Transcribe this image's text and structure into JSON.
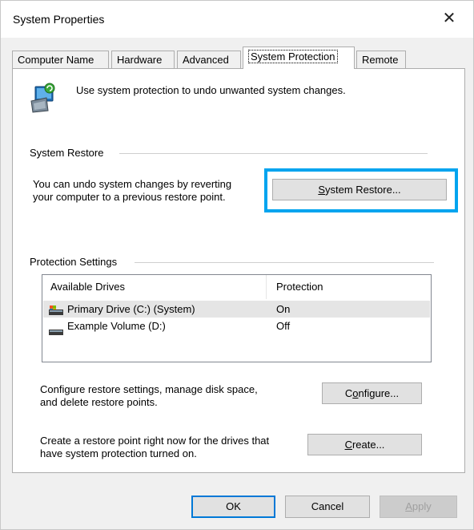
{
  "window": {
    "title": "System Properties",
    "close_glyph": "✕"
  },
  "tabs": [
    {
      "label": "Computer Name",
      "active": false
    },
    {
      "label": "Hardware",
      "active": false
    },
    {
      "label": "Advanced",
      "active": false
    },
    {
      "label": "System Protection",
      "active": true
    },
    {
      "label": "Remote",
      "active": false
    }
  ],
  "intro": {
    "icon": "system-protection-icon",
    "text": "Use system protection to undo unwanted system changes."
  },
  "system_restore": {
    "group_label": "System Restore",
    "description_line1": "You can undo system changes by reverting",
    "description_line2": "your computer to a previous restore point.",
    "button_label_prefix": "S",
    "button_label_rest": "ystem Restore...",
    "highlight_color": "#00a4ef"
  },
  "protection": {
    "group_label": "Protection Settings",
    "columns": [
      "Available Drives",
      "Protection"
    ],
    "drives": [
      {
        "name": "Primary Drive (C:) (System)",
        "protection": "On",
        "icon": "system-drive-icon",
        "selected": true
      },
      {
        "name": "Example Volume (D:)",
        "protection": "Off",
        "icon": "drive-icon",
        "selected": false
      }
    ]
  },
  "configure": {
    "line1": "Configure restore settings, manage disk space,",
    "line2": "and delete restore points.",
    "button_pre": "C",
    "button_u": "o",
    "button_post": "nfigure..."
  },
  "create": {
    "line1": "Create a restore point right now for the drives that",
    "line2": "have system protection turned on.",
    "button_u": "C",
    "button_post": "reate..."
  },
  "footer": {
    "ok": "OK",
    "cancel": "Cancel",
    "apply_u": "A",
    "apply_post": "pply"
  }
}
